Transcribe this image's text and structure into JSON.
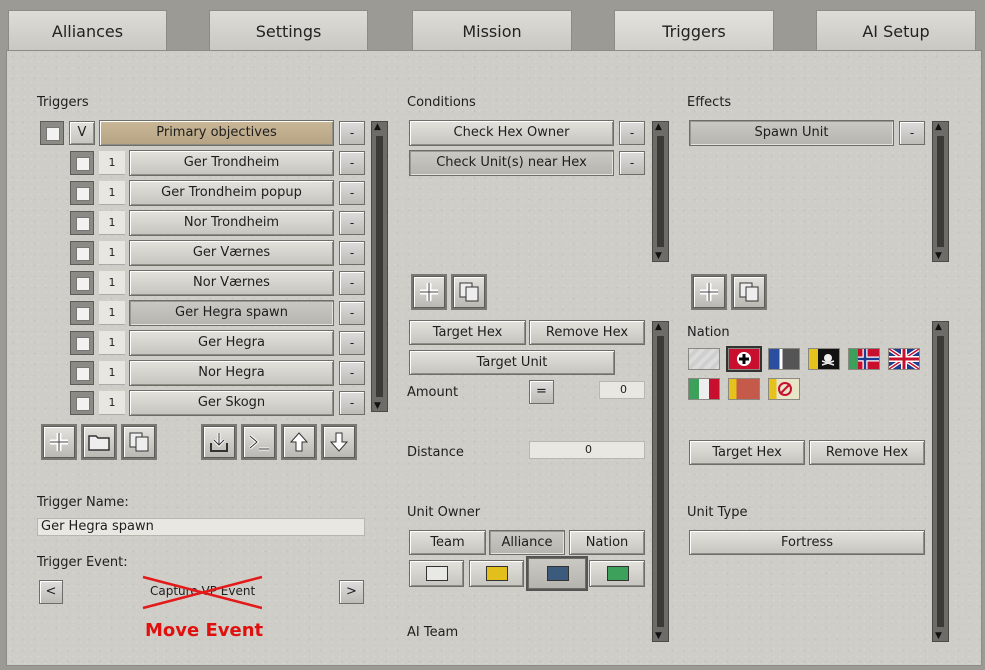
{
  "tabs": [
    "Alliances",
    "Settings",
    "Mission",
    "Triggers",
    "AI Setup"
  ],
  "triggers": {
    "label": "Triggers",
    "group_toggle": "V",
    "group_label": "Primary objectives",
    "minus": "-",
    "items": [
      {
        "num": "1",
        "label": "Ger Trondheim"
      },
      {
        "num": "1",
        "label": "Ger Trondheim popup"
      },
      {
        "num": "1",
        "label": "Nor Trondheim"
      },
      {
        "num": "1",
        "label": "Ger Værnes"
      },
      {
        "num": "1",
        "label": "Nor Værnes"
      },
      {
        "num": "1",
        "label": "Ger Hegra spawn"
      },
      {
        "num": "1",
        "label": "Ger Hegra"
      },
      {
        "num": "1",
        "label": "Nor Hegra"
      },
      {
        "num": "1",
        "label": "Ger Skogn"
      }
    ],
    "name_label": "Trigger Name:",
    "name_value": "Ger Hegra spawn",
    "event_label": "Trigger Event:",
    "event_prev": "<",
    "event_next": ">",
    "event_value": "Capture VP Event",
    "event_annotation": "Move Event"
  },
  "conditions": {
    "label": "Conditions",
    "items": [
      "Check Hex Owner",
      "Check Unit(s) near Hex"
    ],
    "target_hex": "Target Hex",
    "remove_hex": "Remove Hex",
    "target_unit": "Target Unit",
    "amount_label": "Amount",
    "amount_op": "=",
    "amount_value": "0",
    "distance_label": "Distance",
    "distance_value": "0",
    "owner_label": "Unit Owner",
    "owner_tabs": [
      "Team",
      "Alliance",
      "Nation"
    ],
    "ai_team_label": "AI Team",
    "team_colors": [
      "#e8e8e4",
      "#e2bf1a",
      "#3b5a7c",
      "#3da05b"
    ]
  },
  "effects": {
    "label": "Effects",
    "items": [
      "Spawn Unit"
    ],
    "nation_label": "Nation",
    "target_hex": "Target Hex",
    "remove_hex": "Remove Hex",
    "unit_type_label": "Unit Type",
    "unit_type_value": "Fortress"
  },
  "icons": [
    "plus-icon",
    "folder-icon",
    "copy-icon",
    "import-icon",
    "console-icon",
    "arrow-up-icon",
    "arrow-down-icon"
  ]
}
